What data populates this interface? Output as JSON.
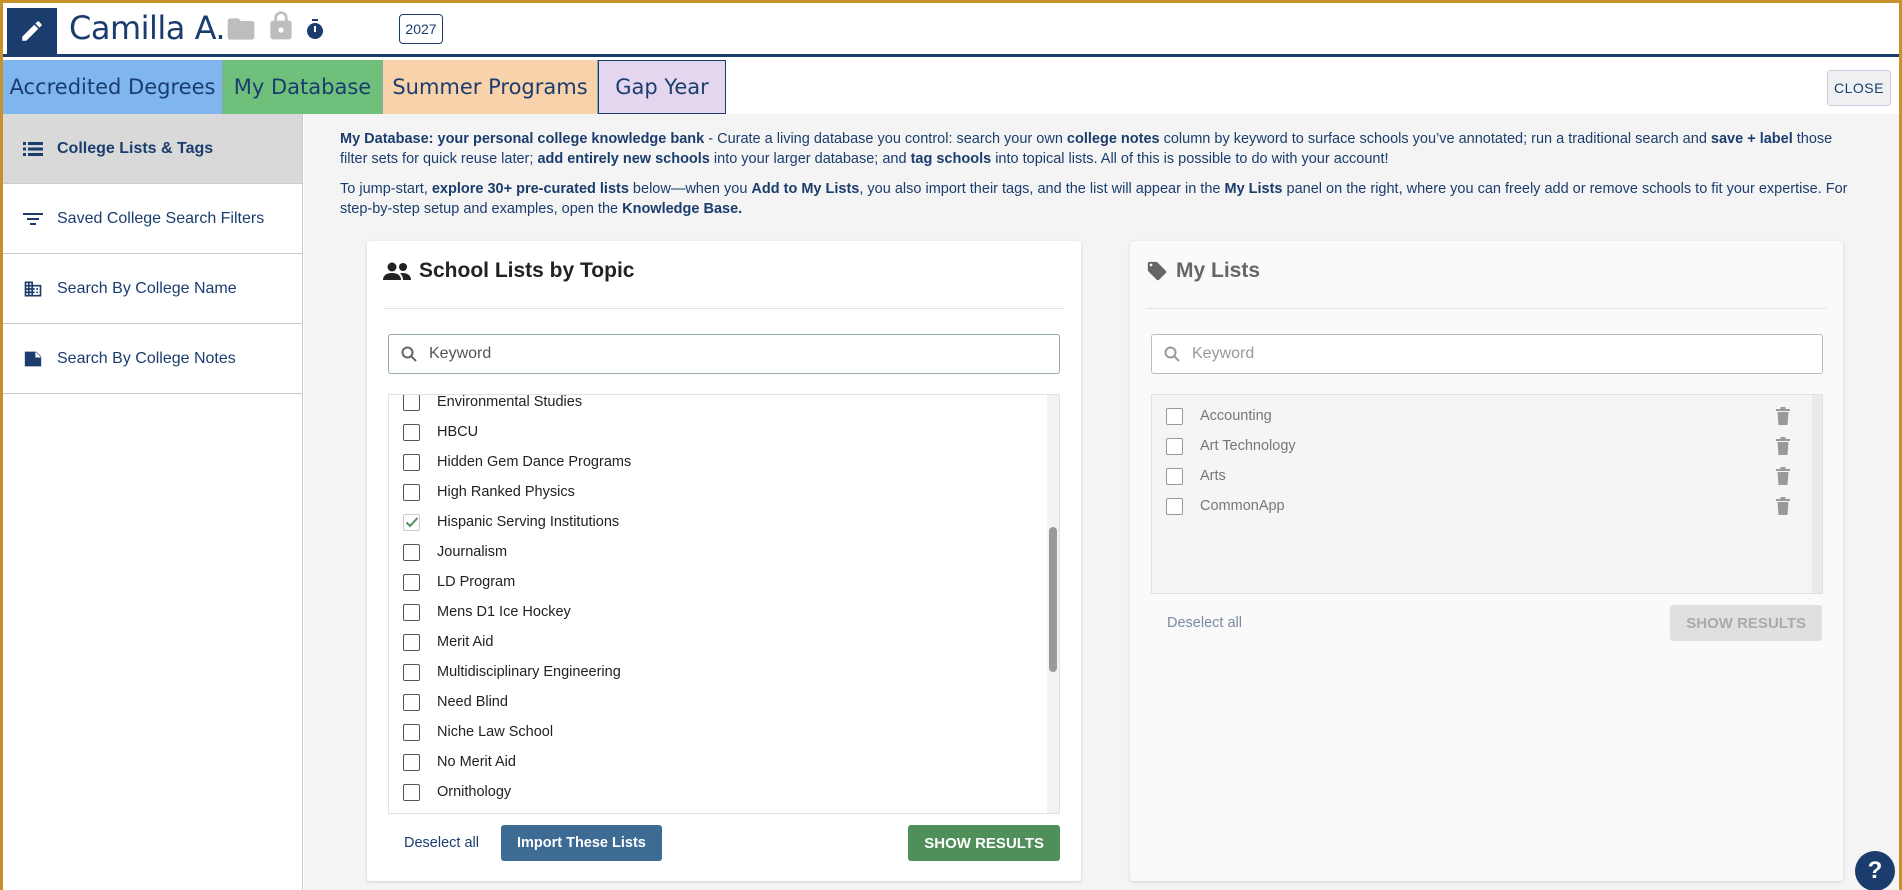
{
  "header": {
    "student_name": "Camilla A.",
    "year": "2027"
  },
  "tabs": [
    {
      "label": "Accredited Degrees"
    },
    {
      "label": "My Database"
    },
    {
      "label": "Summer Programs"
    },
    {
      "label": "Gap Year"
    }
  ],
  "close_label": "CLOSE",
  "sidebar": {
    "items": [
      {
        "label": "College Lists & Tags",
        "icon": "list-icon"
      },
      {
        "label": "Saved College Search Filters",
        "icon": "filter-icon"
      },
      {
        "label": "Search By College Name",
        "icon": "building-icon"
      },
      {
        "label": "Search By College Notes",
        "icon": "note-icon"
      }
    ]
  },
  "intro": {
    "p1": {
      "b1": "My Database: your personal college knowledge bank",
      "t1": " - Curate a living database you control: search your own ",
      "b2": "college notes",
      "t2": " column by keyword to surface schools you’ve annotated; run a traditional search and ",
      "b3": "save + label",
      "t3": " those filter sets for quick reuse later; ",
      "b4": "add entirely new schools",
      "t4": " into your larger database; and ",
      "b5": "tag schools",
      "t5": " into topical lists. All of this is possible to do with your account!"
    },
    "p2": {
      "t1": "To jump-start, ",
      "b1": "explore 30+ pre-curated lists",
      "t2": " below—when you ",
      "b2": "Add to My Lists",
      "t3": ", you also import their tags, and the list will appear in the ",
      "b3": "My Lists",
      "t4": " panel on the right, where you can freely add or remove schools to fit your expertise. For step-by-step setup and examples, open the ",
      "b4": "Knowledge Base."
    }
  },
  "topic_panel": {
    "title": "School Lists by Topic",
    "search_placeholder": "Keyword",
    "items": [
      {
        "label": "Environmental Studies",
        "checked": false
      },
      {
        "label": "HBCU",
        "checked": false
      },
      {
        "label": "Hidden Gem Dance Programs",
        "checked": false
      },
      {
        "label": "High Ranked Physics",
        "checked": false
      },
      {
        "label": "Hispanic Serving Institutions",
        "checked": true
      },
      {
        "label": "Journalism",
        "checked": false
      },
      {
        "label": "LD Program",
        "checked": false
      },
      {
        "label": "Mens D1 Ice Hockey",
        "checked": false
      },
      {
        "label": "Merit Aid",
        "checked": false
      },
      {
        "label": "Multidisciplinary Engineering",
        "checked": false
      },
      {
        "label": "Need Blind",
        "checked": false
      },
      {
        "label": "Niche Law School",
        "checked": false
      },
      {
        "label": "No Merit Aid",
        "checked": false
      },
      {
        "label": "Ornithology",
        "checked": false
      }
    ],
    "deselect_label": "Deselect all",
    "import_label": "Import These Lists",
    "show_label": "SHOW RESULTS"
  },
  "my_lists_panel": {
    "title": "My Lists",
    "search_placeholder": "Keyword",
    "items": [
      {
        "label": "Accounting"
      },
      {
        "label": "Art Technology"
      },
      {
        "label": "Arts"
      },
      {
        "label": "CommonApp"
      }
    ],
    "deselect_label": "Deselect all",
    "show_label": "SHOW RESULTS"
  },
  "help_label": "?",
  "colors": {
    "navy": "#1b3d6e",
    "tab_accredited": "#7fb6f0",
    "tab_database": "#6fc07a",
    "tab_summer": "#f8d2aa",
    "tab_gap": "#e4d6ee",
    "check_green": "#4f8f5a"
  }
}
